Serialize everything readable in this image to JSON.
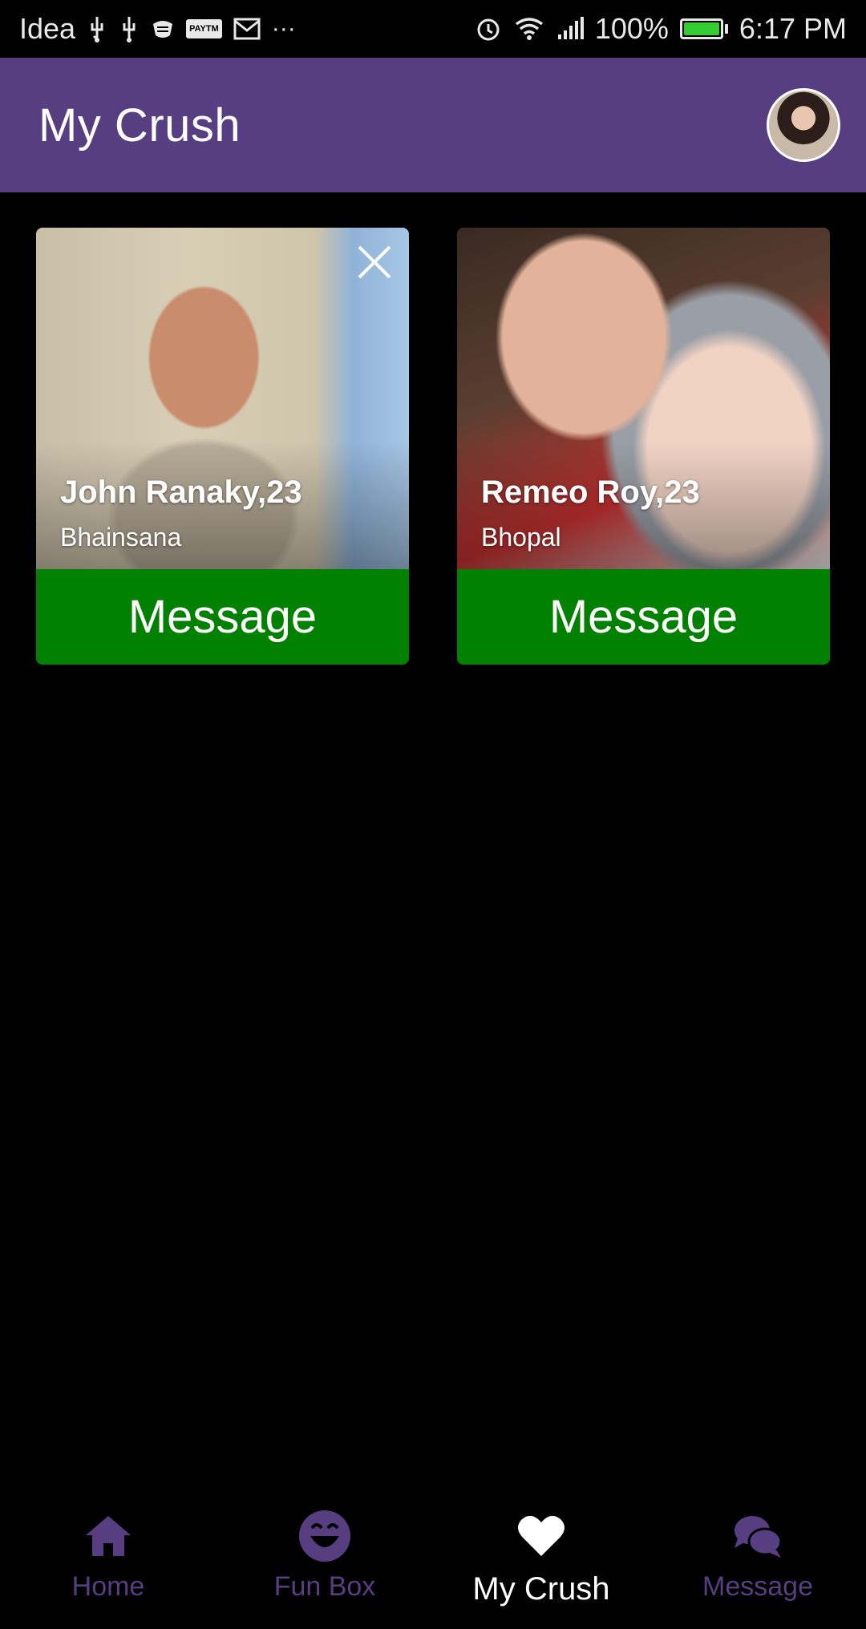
{
  "status_bar": {
    "carrier": "Idea",
    "notif_icons": [
      "usb-icon",
      "usb-icon",
      "shield-icon",
      "paytm-icon",
      "gmail-icon",
      "more-icon"
    ],
    "more_glyph": "···",
    "paytm_label": "PAYTM",
    "battery_percent": "100%",
    "time": "6:17 PM",
    "battery_color": "#33cc33"
  },
  "app_bar": {
    "title": "My Crush",
    "color": "#573e80"
  },
  "cards": [
    {
      "name": "John Ranaky,23",
      "city": "Bhainsana",
      "button_label": "Message",
      "has_close": true
    },
    {
      "name": "Remeo Roy,23",
      "city": "Bhopal",
      "button_label": "Message",
      "has_close": false
    }
  ],
  "button_color": "#028000",
  "bottom_nav": {
    "items": [
      {
        "label": "Home",
        "icon": "home-icon",
        "active": false
      },
      {
        "label": "Fun Box",
        "icon": "smiley-icon",
        "active": false
      },
      {
        "label": "My Crush",
        "icon": "heart-icon",
        "active": true
      },
      {
        "label": "Message",
        "icon": "chat-bubbles-icon",
        "active": false
      }
    ]
  }
}
